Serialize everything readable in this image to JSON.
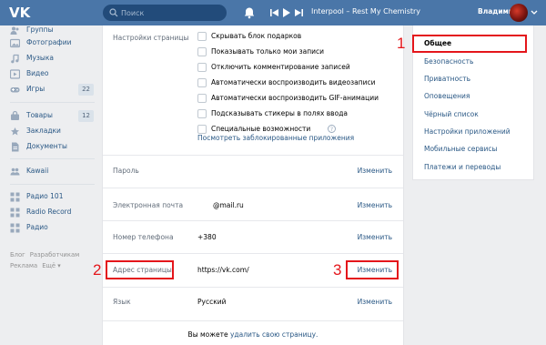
{
  "header": {
    "logo": "VK",
    "search_placeholder": "Поиск",
    "track": "Interpool – Rest My Chemistry",
    "username": "Владимир"
  },
  "sidebar": {
    "items": [
      {
        "label": "Группы",
        "icon": "groups-icon"
      },
      {
        "label": "Фотографии",
        "icon": "photos-icon"
      },
      {
        "label": "Музыка",
        "icon": "music-icon"
      },
      {
        "label": "Видео",
        "icon": "video-icon"
      },
      {
        "label": "Игры",
        "icon": "games-icon",
        "count": "22"
      },
      {
        "label": "Товары",
        "icon": "goods-icon",
        "count": "12"
      },
      {
        "label": "Закладки",
        "icon": "bookmarks-icon"
      },
      {
        "label": "Документы",
        "icon": "documents-icon"
      },
      {
        "label": "Kawaii",
        "icon": "community-icon"
      },
      {
        "label": "Радио 101",
        "icon": "app-icon"
      },
      {
        "label": "Radio Record",
        "icon": "app-icon"
      },
      {
        "label": "Радио",
        "icon": "app-icon"
      }
    ],
    "footer": [
      "Блог",
      "Разработчикам",
      "Реклама",
      "Ещё ▾"
    ]
  },
  "settings": {
    "page_settings_label": "Настройки страницы",
    "checkboxes": [
      "Скрывать блок подарков",
      "Показывать только мои записи",
      "Отключить комментирование записей",
      "Автоматически воспроизводить видеозаписи",
      "Автоматически воспроизводить GIF-анимации",
      "Подсказывать стикеры в полях ввода",
      "Специальные возможности"
    ],
    "blocked_apps_link": "Посмотреть заблокированные приложения",
    "rows": {
      "password": {
        "label": "Пароль",
        "action": "Изменить"
      },
      "email": {
        "label": "Электронная почта",
        "value": "@mail.ru",
        "action": "Изменить"
      },
      "phone": {
        "label": "Номер телефона",
        "value": "+380",
        "action": "Изменить"
      },
      "address": {
        "label": "Адрес страницы",
        "value": "https://vk.com/",
        "action": "Изменить"
      },
      "language": {
        "label": "Язык",
        "value": "Русский",
        "action": "Изменить"
      }
    },
    "delete_prefix": "Вы можете ",
    "delete_link": "удалить свою страницу."
  },
  "right_menu": {
    "items": [
      {
        "label": "Общее",
        "active": true
      },
      {
        "label": "Безопасность"
      },
      {
        "label": "Приватность"
      },
      {
        "label": "Оповещения"
      },
      {
        "label": "Чёрный список"
      },
      {
        "label": "Настройки приложений"
      },
      {
        "label": "Мобильные сервисы"
      },
      {
        "label": "Платежи и переводы"
      }
    ]
  },
  "annotations": {
    "one": "1",
    "two": "2",
    "three": "3",
    "color": "#e4161b"
  },
  "colors": {
    "header": "#4a76a8",
    "link": "#2a5885",
    "background": "#edeef0"
  }
}
